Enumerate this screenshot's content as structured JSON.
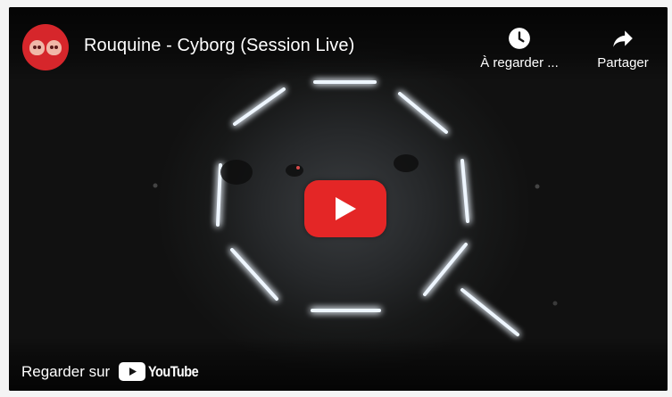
{
  "video": {
    "title": "Rouquine - Cyborg (Session Live)",
    "channel_avatar_icon": "skull-duo-icon"
  },
  "actions": {
    "watch_later_label": "À regarder ...",
    "share_label": "Partager"
  },
  "footer": {
    "watch_on_label": "Regarder sur",
    "youtube_wordmark": "YouTube"
  },
  "colors": {
    "accent_red": "#e42626",
    "avatar_red": "#d6262b",
    "light_tube": "#eef6ff",
    "background": "#151515"
  }
}
